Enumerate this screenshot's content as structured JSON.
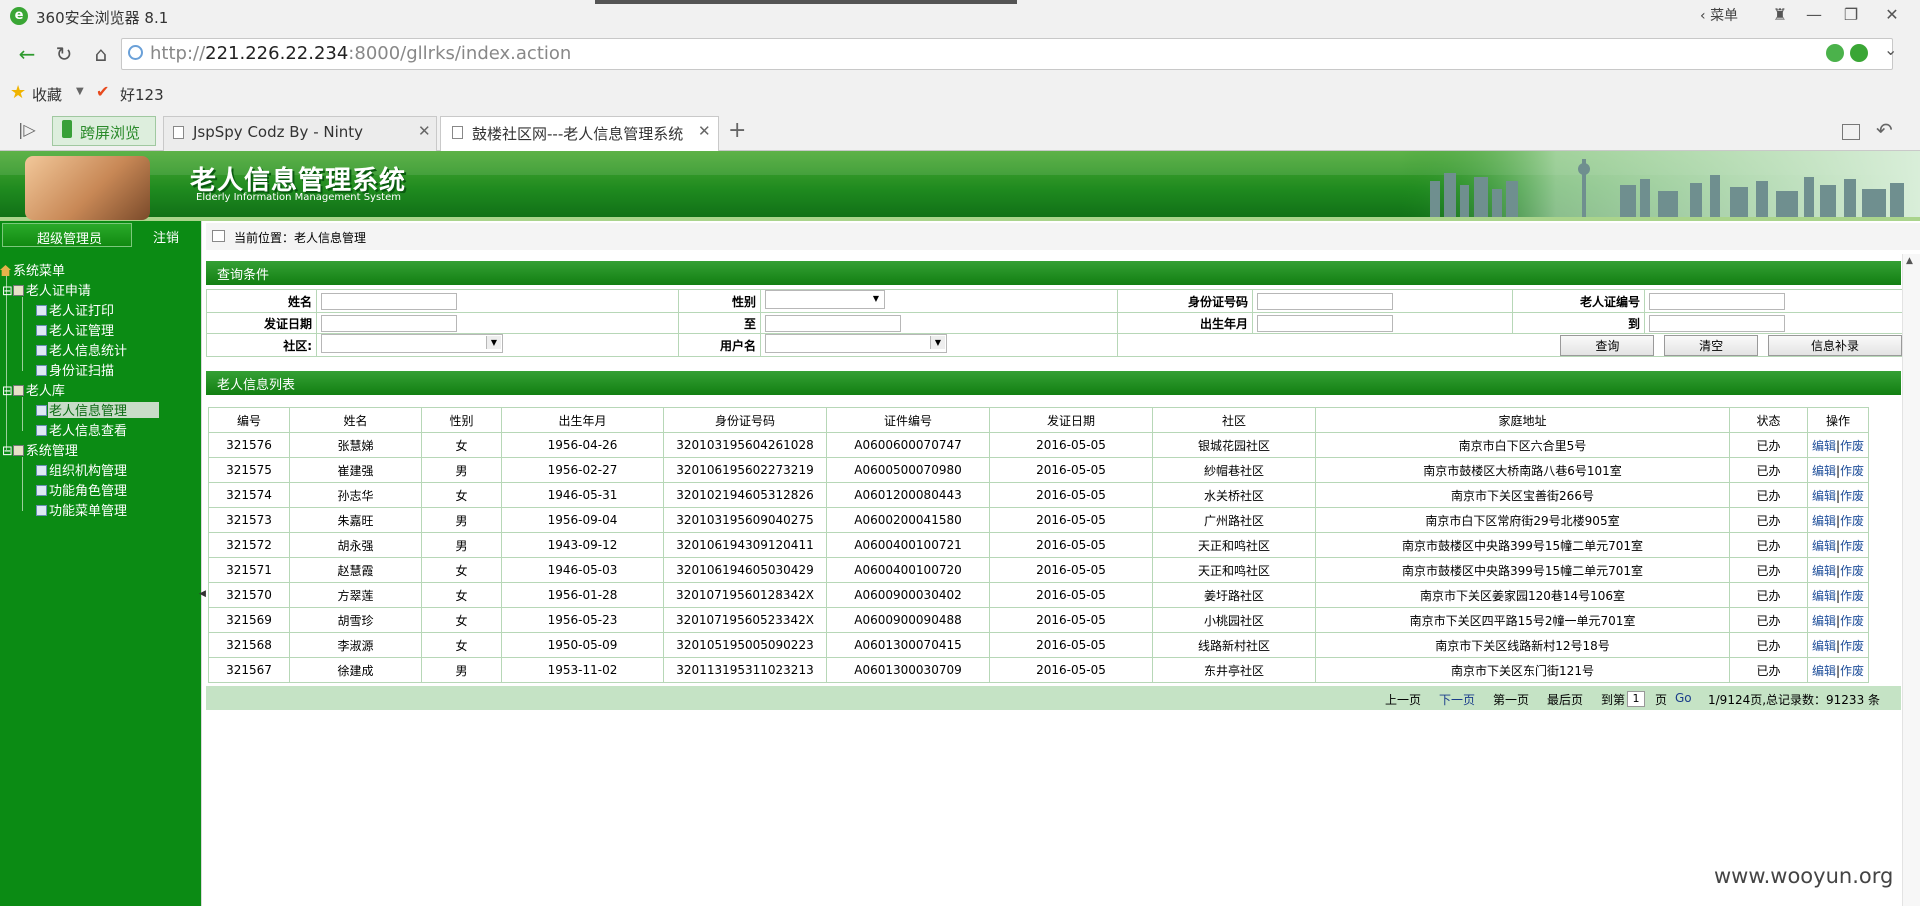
{
  "browser": {
    "title": "360安全浏览器 8.1",
    "menu_label": "菜单",
    "url_scheme": "http://",
    "url_host": "221.226.22.234",
    "url_rest": ":8000/gllrks/index.action",
    "favorites_label": "收藏",
    "hao_label": "好123",
    "split_view_label": "跨屏浏览",
    "tabs": [
      {
        "label": "JspSpy Codz By - Ninty"
      },
      {
        "label": "鼓楼社区网---老人信息管理系统"
      }
    ],
    "new_tab_symbol": "+"
  },
  "banner": {
    "title": "老人信息管理系统",
    "subtitle": "Elderly Information Management System"
  },
  "sidebar": {
    "admin_label": "超级管理员",
    "logout_label": "注销",
    "tree": [
      {
        "label": "系统菜单"
      },
      {
        "label": "老人证申请"
      },
      {
        "label": "老人证打印"
      },
      {
        "label": "老人证管理"
      },
      {
        "label": "老人信息统计"
      },
      {
        "label": "身份证扫描"
      },
      {
        "label": "老人库"
      },
      {
        "label": "老人信息管理"
      },
      {
        "label": "老人信息查看"
      },
      {
        "label": "系统管理"
      },
      {
        "label": "组织机构管理"
      },
      {
        "label": "功能角色管理"
      },
      {
        "label": "功能菜单管理"
      }
    ]
  },
  "breadcrumb": "当前位置：老人信息管理",
  "query": {
    "section_title": "查询条件",
    "labels": {
      "name": "姓名",
      "gender": "性别",
      "id_no": "身份证号码",
      "card_no": "老人证编号",
      "issue_date": "发证日期",
      "to1": "至",
      "birth": "出生年月",
      "to2": "到",
      "community": "社区:",
      "username": "用户名"
    },
    "buttons": {
      "search": "查询",
      "clear": "清空",
      "supplement": "信息补录"
    }
  },
  "list": {
    "section_title": "老人信息列表",
    "columns": [
      "编号",
      "姓名",
      "性别",
      "出生年月",
      "身份证号码",
      "证件编号",
      "发证日期",
      "社区",
      "家庭地址",
      "状态",
      "操作"
    ],
    "rows": [
      {
        "no": "321576",
        "name": "张慧娣",
        "gender": "女",
        "birth": "1956-04-26",
        "id": "320103195604261028",
        "cert": "A0600600070747",
        "date": "2016-05-05",
        "community": "银城花园社区",
        "address": "南京市白下区六合里5号",
        "status": "已办"
      },
      {
        "no": "321575",
        "name": "崔建强",
        "gender": "男",
        "birth": "1956-02-27",
        "id": "320106195602273219",
        "cert": "A0600500070980",
        "date": "2016-05-05",
        "community": "紗帽巷社区",
        "address": "南京市鼓楼区大桥南路八巷6号101室",
        "status": "已办"
      },
      {
        "no": "321574",
        "name": "孙志华",
        "gender": "女",
        "birth": "1946-05-31",
        "id": "320102194605312826",
        "cert": "A0601200080443",
        "date": "2016-05-05",
        "community": "水关桥社区",
        "address": "南京市下关区宝善街266号",
        "status": "已办"
      },
      {
        "no": "321573",
        "name": "朱嘉旺",
        "gender": "男",
        "birth": "1956-09-04",
        "id": "320103195609040275",
        "cert": "A0600200041580",
        "date": "2016-05-05",
        "community": "广州路社区",
        "address": "南京市白下区常府街29号北楼905室",
        "status": "已办"
      },
      {
        "no": "321572",
        "name": "胡永强",
        "gender": "男",
        "birth": "1943-09-12",
        "id": "320106194309120411",
        "cert": "A0600400100721",
        "date": "2016-05-05",
        "community": "天正和鸣社区",
        "address": "南京市鼓楼区中央路399号15幢二单元701室",
        "status": "已办"
      },
      {
        "no": "321571",
        "name": "赵慧霞",
        "gender": "女",
        "birth": "1946-05-03",
        "id": "320106194605030429",
        "cert": "A0600400100720",
        "date": "2016-05-05",
        "community": "天正和鸣社区",
        "address": "南京市鼓楼区中央路399号15幢二单元701室",
        "status": "已办"
      },
      {
        "no": "321570",
        "name": "方翠莲",
        "gender": "女",
        "birth": "1956-01-28",
        "id": "32010719560128342X",
        "cert": "A0600900030402",
        "date": "2016-05-05",
        "community": "姜圩路社区",
        "address": "南京市下关区姜家园120巷14号106室",
        "status": "已办"
      },
      {
        "no": "321569",
        "name": "胡雪珍",
        "gender": "女",
        "birth": "1956-05-23",
        "id": "32010719560523342X",
        "cert": "A0600900090488",
        "date": "2016-05-05",
        "community": "小桃园社区",
        "address": "南京市下关区四平路15号2幢一单元701室",
        "status": "已办"
      },
      {
        "no": "321568",
        "name": "李淑源",
        "gender": "女",
        "birth": "1950-05-09",
        "id": "320105195005090223",
        "cert": "A0601300070415",
        "date": "2016-05-05",
        "community": "线路新村社区",
        "address": "南京市下关区线路新村12号18号",
        "status": "已办"
      },
      {
        "no": "321567",
        "name": "徐建成",
        "gender": "男",
        "birth": "1953-11-02",
        "id": "320113195311023213",
        "cert": "A0601300030709",
        "date": "2016-05-05",
        "community": "东井亭社区",
        "address": "南京市下关区东门街121号",
        "status": "已办"
      }
    ],
    "op_edit": "编辑",
    "op_sep": "|",
    "op_void": "作废"
  },
  "pager": {
    "prev": "上一页",
    "next": "下一页",
    "first": "第一页",
    "last": "最后页",
    "goto_prefix": "到第",
    "goto_value": "1",
    "page_word": "页",
    "go": "Go",
    "summary": "1/9124页,总记录数：91233 条"
  },
  "watermark": "www.wooyun.org"
}
